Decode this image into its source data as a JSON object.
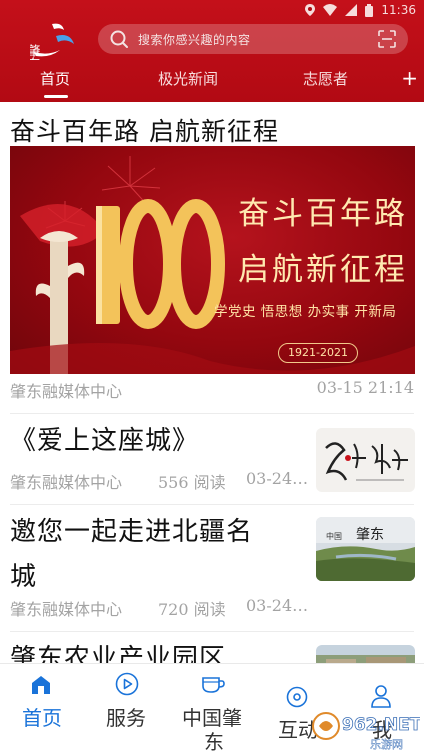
{
  "colors": {
    "header_red": "#b20a13",
    "active_blue": "#1a73d9",
    "meta_gray": "#a3a3a3"
  },
  "status_bar": {
    "time": "11:36"
  },
  "header": {
    "logo_text": "肇东",
    "search_placeholder": "搜索你感兴趣的内容",
    "tabs": [
      {
        "label": "首页",
        "active": true
      },
      {
        "label": "极光新闻",
        "active": false
      },
      {
        "label": "志愿者",
        "active": false
      }
    ],
    "more": "+"
  },
  "feed": {
    "top_story": {
      "title": "奋斗百年路 启航新征程",
      "banner": {
        "line1": "奋斗百年路",
        "line2": "启航新征程",
        "slogan": "学党史 悟思想 办实事 开新局",
        "years": "1921-2021",
        "number": "100"
      },
      "source": "肇东融媒体中心",
      "time": "03-15 21:14"
    },
    "items": [
      {
        "title": "《爱上这座城》",
        "source": "肇东融媒体中心",
        "reads": "556 阅读",
        "time": "03-24…",
        "thumb_icon": "calligraphy-thumbnail"
      },
      {
        "title_line1": "邀您一起走进北疆名",
        "title_line2": "城",
        "source": "肇东融媒体中心",
        "reads": "720 阅读",
        "time": "03-24…",
        "thumb_icon": "landscape-thumbnail"
      },
      {
        "title": "肇东农业产业园区",
        "thumb_icon": "aerial-thumbnail"
      }
    ]
  },
  "bottom_nav": [
    {
      "label": "首页",
      "active": true,
      "icon": "home-icon"
    },
    {
      "label": "服务",
      "active": false,
      "icon": "play-circle-icon"
    },
    {
      "label_line1": "中国肇",
      "label_line2": "东",
      "active": false,
      "icon": "cup-icon"
    },
    {
      "label": "互动",
      "active": false,
      "icon": "disc-icon"
    },
    {
      "label": "我",
      "active": false,
      "icon": "user-icon"
    }
  ],
  "watermark": {
    "text": "962.NET",
    "sub": "乐游网"
  }
}
